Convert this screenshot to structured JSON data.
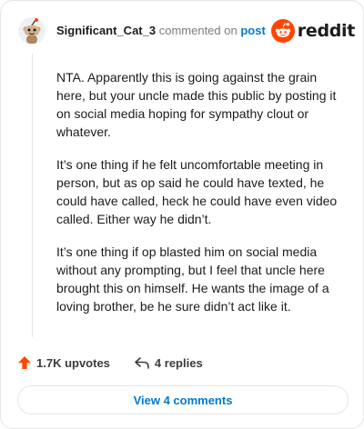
{
  "comment": {
    "username": "Significant_Cat_3",
    "action": "commented on",
    "target": "post",
    "avatar_icon": "snoo-avatar-icon",
    "paragraphs": [
      "NTA. Apparently this is going against the grain here, but your uncle made this public by posting it on social media hoping for sympathy clout or whatever.",
      "It’s one thing if he felt uncomfortable meeting in person, but as op said he could have texted, he could have called, heck he could have even video called. Either way he didn’t.",
      "It’s one thing if op blasted him on social media without any prompting, but I feel that uncle here brought this on himself. He wants the image of a loving brother, be he sure didn’t act like it."
    ]
  },
  "brand": {
    "name": "reddit",
    "icon": "reddit-snoo-logo-icon",
    "color": "#ff4500"
  },
  "stats": {
    "upvotes": "1.7K upvotes",
    "upvote_icon": "upvote-arrow-icon",
    "replies": "4 replies",
    "reply_icon": "reply-arrow-icon"
  },
  "view_comments_label": "View 4 comments",
  "colors": {
    "link": "#0079d3",
    "upvote": "#ff4500",
    "muted": "#7c7c7c",
    "border": "#e6e6e6"
  }
}
